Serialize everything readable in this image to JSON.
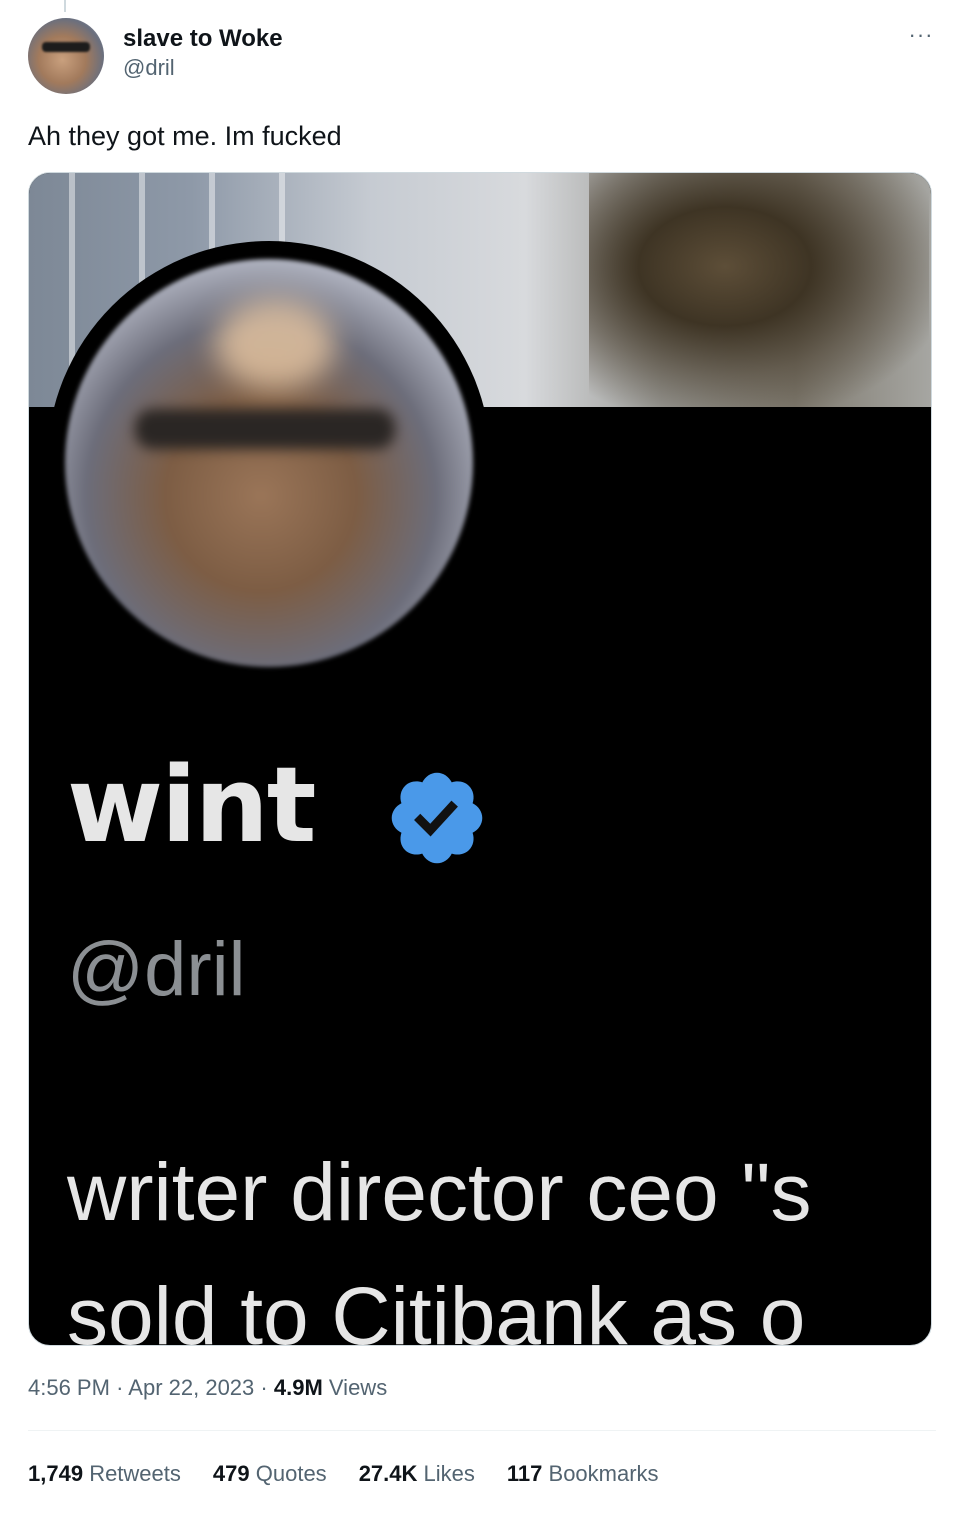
{
  "author": {
    "display_name": "slave to Woke",
    "handle": "@dril"
  },
  "more_icon": "more-horizontal-icon",
  "tweet": {
    "text": "Ah they got me. Im fucked"
  },
  "media": {
    "profile_name": "wint",
    "verified_icon": "verified-badge-icon",
    "verified_color": "#4a99e9",
    "profile_handle": "@dril",
    "bio_line_1": "writer director ceo \"s",
    "bio_line_2": "sold to Citibank as o"
  },
  "meta": {
    "time": "4:56 PM",
    "date": "Apr 22, 2023",
    "views_count": "4.9M",
    "views_label": "Views"
  },
  "stats": [
    {
      "num": "1,749",
      "label": "Retweets"
    },
    {
      "num": "479",
      "label": "Quotes"
    },
    {
      "num": "27.4K",
      "label": "Likes"
    },
    {
      "num": "117",
      "label": "Bookmarks"
    }
  ]
}
